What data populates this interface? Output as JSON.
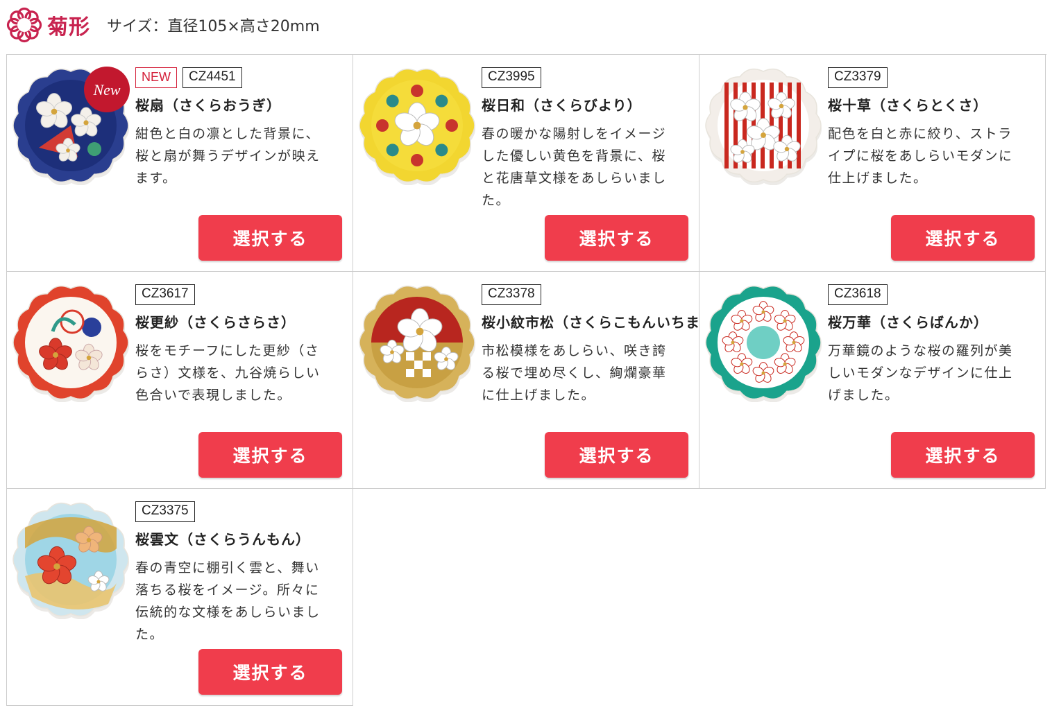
{
  "header": {
    "logo_icon": "chrysanthemum-icon",
    "title": "菊形",
    "size_text": "サイズ：直径105×高さ20mm",
    "accent_color": "#c8234f"
  },
  "button_color": "#f03d4c",
  "products": [
    {
      "is_new": true,
      "new_label": "NEW",
      "badge_text": "New",
      "code": "CZ4451",
      "name": "桜扇（さくらおうぎ）",
      "description": "紺色と白の凛とした背景に、桜と扇が舞うデザインが映えます。",
      "button_label": "選択する",
      "plate_colors": {
        "rim": "#2a3e8f",
        "base": "#1d2f7a",
        "accent": "#ffffff",
        "flower": "#f4f0ea",
        "detail": "#d23b34"
      }
    },
    {
      "is_new": false,
      "code": "CZ3995",
      "name": "桜日和（さくらびより）",
      "description": "春の暖かな陽射しをイメージした優しい黄色を背景に、桜と花唐草文様をあしらいました。",
      "button_label": "選択する",
      "plate_colors": {
        "rim": "#f2d630",
        "base": "#f5dc3a",
        "accent": "#2a8a8a",
        "flower": "#ffffff",
        "detail": "#c8342d"
      }
    },
    {
      "is_new": false,
      "code": "CZ3379",
      "name": "桜十草（さくらとくさ）",
      "description": "配色を白と赤に絞り、ストライプに桜をあしらいモダンに仕上げました。",
      "button_label": "選択する",
      "plate_colors": {
        "rim": "#f3eee9",
        "base": "#ffffff",
        "accent": "#c9281f",
        "flower": "#ffffff",
        "detail": "#c9281f"
      }
    },
    {
      "is_new": false,
      "code": "CZ3617",
      "name": "桜更紗（さくらさらさ）",
      "description": "桜をモチーフにした更紗（さらさ）文様を、九谷焼らしい色合いで表現しました。",
      "button_label": "選択する",
      "plate_colors": {
        "rim": "#e0432c",
        "base": "#fbf6ef",
        "accent": "#2a3f9a",
        "flower": "#d93a2b",
        "detail": "#2f9a8a"
      }
    },
    {
      "is_new": false,
      "code": "CZ3378",
      "name": "桜小紋市松（さくらこもんいちまつ）",
      "description": "市松模様をあしらい、咲き誇る桜で埋め尽くし、絢爛豪華に仕上げました。",
      "button_label": "選択する",
      "plate_colors": {
        "rim": "#d6b25a",
        "base": "#c8a043",
        "accent": "#b8261f",
        "flower": "#ffffff",
        "detail": "#e6cd7e"
      }
    },
    {
      "is_new": false,
      "code": "CZ3618",
      "name": "桜万華（さくらばんか）",
      "description": "万華鏡のような桜の羅列が美しいモダンなデザインに仕上げました。",
      "button_label": "選択する",
      "plate_colors": {
        "rim": "#1aa38c",
        "base": "#ffffff",
        "accent": "#6fcfc4",
        "flower": "#ffffff",
        "detail": "#c9281f"
      }
    },
    {
      "is_new": false,
      "code": "CZ3375",
      "name": "桜雲文（さくらうんもん）",
      "description": "春の青空に棚引く雲と、舞い落ちる桜をイメージ。所々に伝統的な文様をあしらいました。",
      "button_label": "選択する",
      "plate_colors": {
        "rim": "#cfe6ee",
        "base": "#9fd6e6",
        "accent": "#d4a43c",
        "flower": "#e3452f",
        "detail": "#c9281f"
      }
    }
  ]
}
